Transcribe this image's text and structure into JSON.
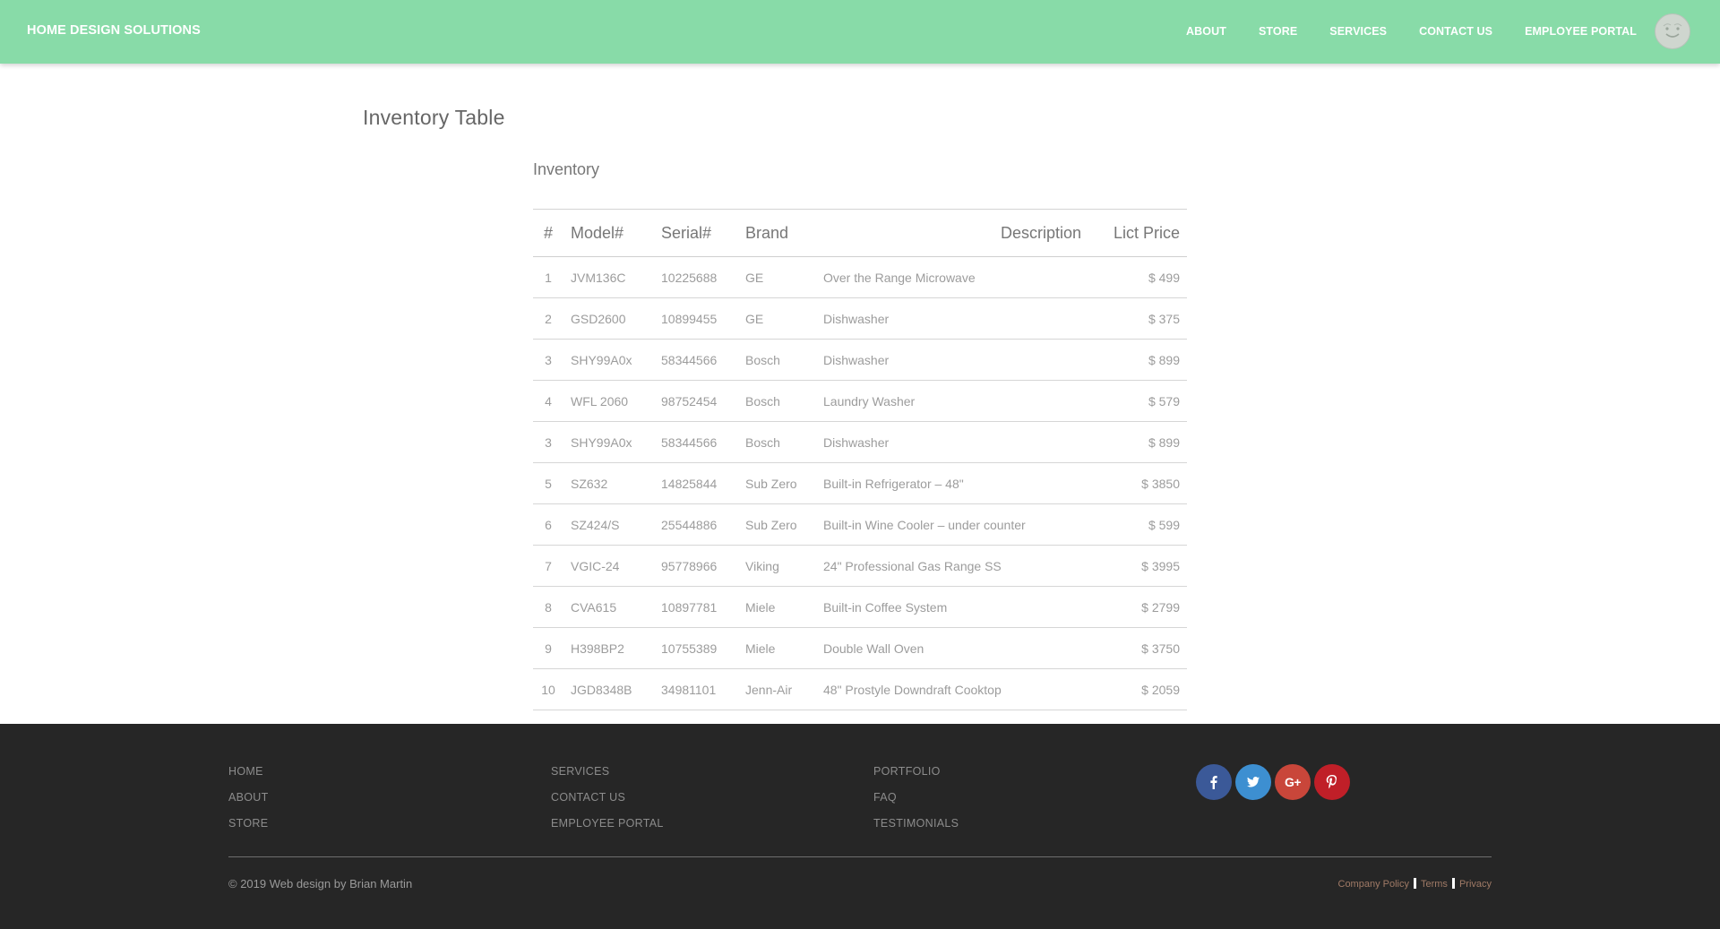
{
  "header": {
    "brand": "HOME DESIGN SOLUTIONS",
    "nav": [
      {
        "label": "ABOUT"
      },
      {
        "label": "STORE"
      },
      {
        "label": "SERVICES"
      },
      {
        "label": "CONTACT US"
      },
      {
        "label": "EMPLOYEE PORTAL"
      }
    ],
    "avatar_icon": "smiley-face-icon"
  },
  "main": {
    "page_title": "Inventory Table",
    "section_title": "Inventory",
    "table": {
      "columns": [
        "#",
        "Model#",
        "Serial#",
        "Brand",
        "Description",
        "Lict Price"
      ],
      "rows": [
        {
          "num": "1",
          "model": "JVM136C",
          "serial": "10225688",
          "brand": "GE",
          "description": "Over the Range Microwave",
          "price": "$ 499"
        },
        {
          "num": "2",
          "model": "GSD2600",
          "serial": "10899455",
          "brand": "GE",
          "description": "Dishwasher",
          "price": "$ 375"
        },
        {
          "num": "3",
          "model": "SHY99A0x",
          "serial": "58344566",
          "brand": "Bosch",
          "description": "Dishwasher",
          "price": "$ 899"
        },
        {
          "num": "4",
          "model": "WFL 2060",
          "serial": "98752454",
          "brand": "Bosch",
          "description": "Laundry Washer",
          "price": "$ 579"
        },
        {
          "num": "3",
          "model": "SHY99A0x",
          "serial": "58344566",
          "brand": "Bosch",
          "description": "Dishwasher",
          "price": "$ 899"
        },
        {
          "num": "5",
          "model": "SZ632",
          "serial": "14825844",
          "brand": "Sub Zero",
          "description": "Built-in Refrigerator – 48\"",
          "price": "$ 3850"
        },
        {
          "num": "6",
          "model": "SZ424/S",
          "serial": "25544886",
          "brand": "Sub Zero",
          "description": "Built-in Wine Cooler – under counter",
          "price": "$ 599"
        },
        {
          "num": "7",
          "model": "VGIC-24",
          "serial": "95778966",
          "brand": "Viking",
          "description": "24\" Professional Gas Range SS",
          "price": "$ 3995"
        },
        {
          "num": "8",
          "model": "CVA615",
          "serial": "10897781",
          "brand": "Miele",
          "description": "Built-in Coffee System",
          "price": "$ 2799"
        },
        {
          "num": "9",
          "model": "H398BP2",
          "serial": "10755389",
          "brand": "Miele",
          "description": "Double Wall Oven",
          "price": "$ 3750"
        },
        {
          "num": "10",
          "model": "JGD8348B",
          "serial": "34981101",
          "brand": "Jenn-Air",
          "description": "48\" Prostyle Downdraft Cooktop",
          "price": "$ 2059"
        }
      ]
    }
  },
  "footer": {
    "columns": [
      [
        "HOME",
        "ABOUT",
        "STORE"
      ],
      [
        "SERVICES",
        "CONTACT US",
        "EMPLOYEE PORTAL"
      ],
      [
        "PORTFOLIO",
        "FAQ",
        "TESTIMONIALS"
      ]
    ],
    "social": [
      {
        "icon": "facebook-icon",
        "glyph": "f",
        "color": "#3b5998"
      },
      {
        "icon": "twitter-icon",
        "glyph": "t",
        "color": "#3d8fd1"
      },
      {
        "icon": "google-plus-icon",
        "glyph": "G+",
        "color": "#c9463a"
      },
      {
        "icon": "pinterest-icon",
        "glyph": "P",
        "color": "#c01f28"
      }
    ],
    "copyright": "© 2019 Web design by Brian Martin",
    "legal": [
      "Company Policy",
      "Terms",
      "Privacy"
    ]
  },
  "colors": {
    "header_bg": "#88dba8",
    "footer_bg": "#262626"
  }
}
